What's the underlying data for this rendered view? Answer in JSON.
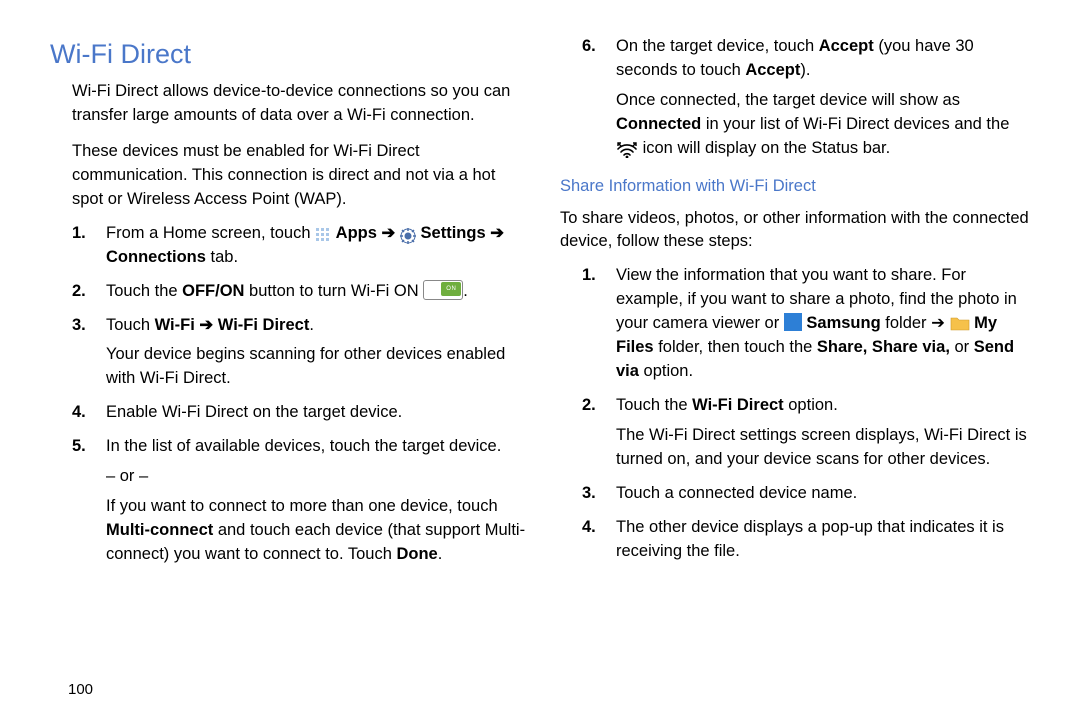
{
  "page_number": "100",
  "left": {
    "title": "Wi-Fi Direct",
    "intro1": "Wi-Fi Direct allows device-to-device connections so you can transfer large amounts of data over a Wi-Fi connection.",
    "intro2": "These devices must be enabled for Wi-Fi Direct communication. This connection is direct and not via a hot spot or Wireless Access Point (WAP).",
    "step1_a": "From a Home screen, touch ",
    "step1_apps": "Apps",
    "step1_arrow": " ➔ ",
    "step1_settings": "Settings",
    "step1_b": " ➔ Connections",
    "step1_tab": " tab.",
    "step2_a": "Touch the ",
    "step2_offon": "OFF/ON",
    "step2_b": " button to turn Wi-Fi ON ",
    "step2_end": ".",
    "step3_a": "Touch ",
    "step3_wifi": "Wi-Fi ➔ Wi-Fi Direct",
    "step3_end": ".",
    "step3_p2": "Your device begins scanning for other devices enabled with Wi-Fi Direct.",
    "step4": "Enable Wi-Fi Direct on the target device.",
    "step5_a": "In the list of available devices, touch the target device.",
    "step5_or": "– or –",
    "step5_b1": "If you want to connect to more than one device, touch ",
    "step5_mc": "Multi-connect",
    "step5_b2": " and touch each device (that support Multi-connect) you want to connect to. Touch ",
    "step5_done": "Done",
    "step5_end": "."
  },
  "right": {
    "step6_a": "On the target device, touch ",
    "step6_accept": "Accept",
    "step6_b": " (you have 30 seconds to touch ",
    "step6_accept2": "Accept",
    "step6_c": ").",
    "step6_p2a": "Once connected, the target device will show as ",
    "step6_connected": "Connected",
    "step6_p2b": " in your list of Wi-Fi Direct devices and the ",
    "step6_p2c": " icon will display on the Status bar.",
    "subheading": "Share Information with Wi-Fi Direct",
    "share_intro": "To share videos, photos, or other information with the connected device, follow these steps:",
    "s1_a": "View the information that you want to share. For example, if you want to share a photo, find the photo in your camera viewer or ",
    "s1_samsung": "Samsung",
    "s1_folder": " folder ➔ ",
    "s1_myfiles": "My Files",
    "s1_b": " folder, then touch the ",
    "s1_share": "Share, Share via,",
    "s1_or": " or ",
    "s1_sendvia": "Send via",
    "s1_option": " option.",
    "s2_a": "Touch the ",
    "s2_wfd": "Wi-Fi Direct",
    "s2_b": " option.",
    "s2_p2": "The Wi-Fi Direct settings screen displays, Wi-Fi Direct is turned on, and your device scans for other devices.",
    "s3": "Touch a connected device name.",
    "s4": "The other device displays a pop-up that indicates it is receiving the file."
  }
}
